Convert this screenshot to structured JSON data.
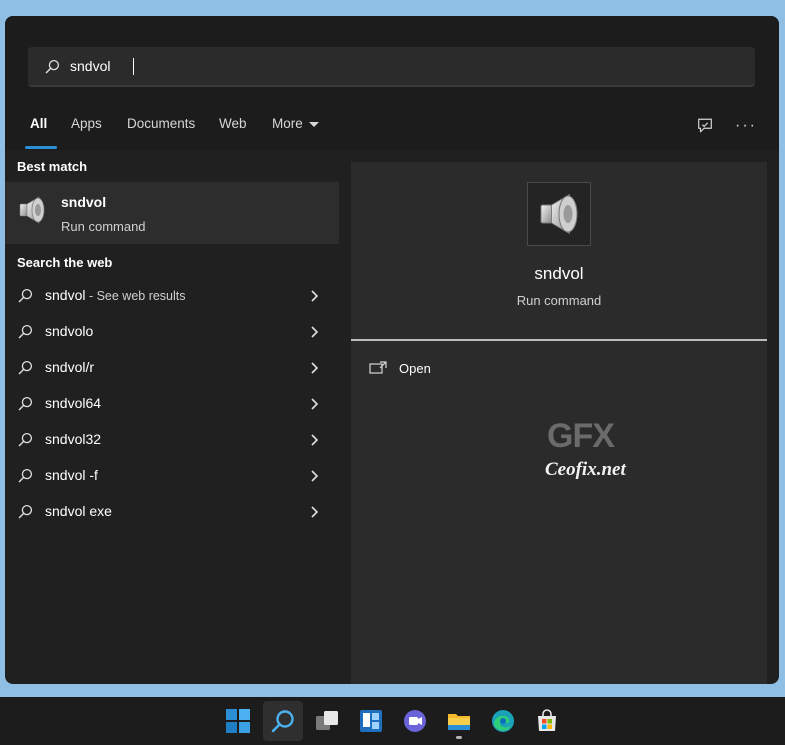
{
  "search": {
    "value": "sndvol"
  },
  "tabs": [
    {
      "label": "All",
      "active": true
    },
    {
      "label": "Apps"
    },
    {
      "label": "Documents"
    },
    {
      "label": "Web"
    },
    {
      "label": "More"
    }
  ],
  "icons": {
    "feedback": "feedback-icon",
    "more_options": "more-options-icon"
  },
  "best_match": {
    "heading": "Best match",
    "title": "sndvol",
    "subtitle": "Run command",
    "icon": "speaker-icon"
  },
  "web": {
    "heading": "Search the web",
    "items": [
      {
        "query": "sndvol",
        "suffix": " - See web results"
      },
      {
        "query": "sndvolo",
        "suffix": ""
      },
      {
        "query": "sndvol/r",
        "suffix": ""
      },
      {
        "query": "sndvol64",
        "suffix": ""
      },
      {
        "query": "sndvol32",
        "suffix": ""
      },
      {
        "query": "sndvol -f",
        "suffix": ""
      },
      {
        "query": "sndvol exe",
        "suffix": ""
      }
    ]
  },
  "preview": {
    "title": "sndvol",
    "subtitle": "Run command",
    "open_label": "Open",
    "watermark_logo": "GFX",
    "watermark_text": "Ceofix.net"
  },
  "taskbar": {
    "items": [
      "windows-start",
      "search",
      "task-view",
      "widgets",
      "teams-chat",
      "file-explorer",
      "edge",
      "microsoft-store"
    ]
  },
  "colors": {
    "accent": "#2b8fd6",
    "panel": "#202020",
    "preview": "#2b2b2b",
    "desktop": "#8fbfe4"
  }
}
